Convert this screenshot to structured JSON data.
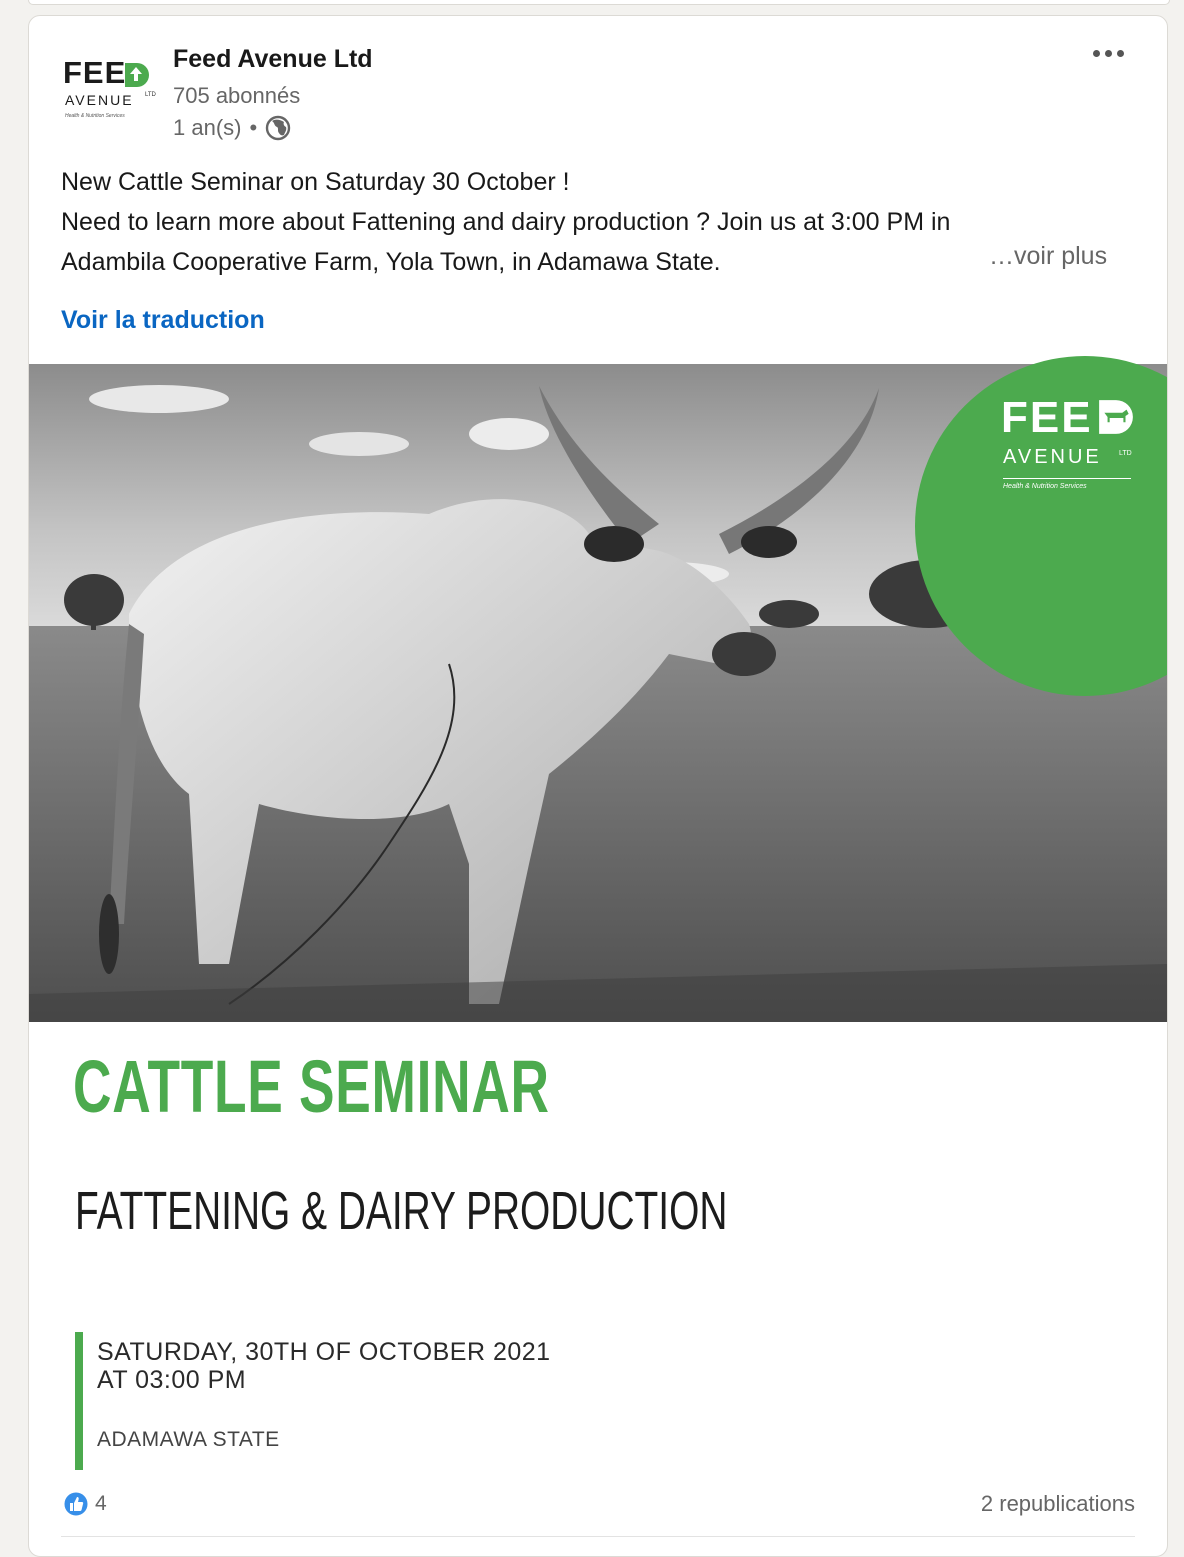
{
  "post": {
    "author_name": "Feed Avenue Ltd",
    "followers": "705 abonnés",
    "time_ago": "1 an(s)",
    "separator": "•",
    "text_lines": [
      "New Cattle Seminar on Saturday 30 October !",
      "Need to learn more about Fattening and dairy production ? Join us at 3:00 PM in",
      "Adambila Cooperative Farm, Yola Town, in Adamawa State."
    ],
    "see_more": "…voir plus",
    "translate": "Voir la traduction"
  },
  "logo": {
    "word1": "FEE",
    "word2": "AVENUE",
    "ltd": "LTD",
    "tagline": "Health & Nutrition Services"
  },
  "poster": {
    "title": "CATTLE SEMINAR",
    "subtitle": "FATTENING & DAIRY PRODUCTION",
    "date_line1": "SATURDAY, 30TH OF OCTOBER 2021",
    "date_line2": "AT 03:00 PM",
    "location": "ADAMAWA STATE",
    "badge_word1": "FEE",
    "badge_word2": "AVENUE",
    "badge_ltd": "LTD",
    "badge_tagline": "Health & Nutrition Services"
  },
  "footer": {
    "reaction_count": "4",
    "reposts": "2 republications"
  },
  "colors": {
    "brand_green": "#4caa4e",
    "link_blue": "#0a66c2",
    "muted_text": "#666666"
  },
  "icons": {
    "more": "more-horizontal-icon",
    "visibility": "globe-icon",
    "reaction": "like-icon"
  }
}
